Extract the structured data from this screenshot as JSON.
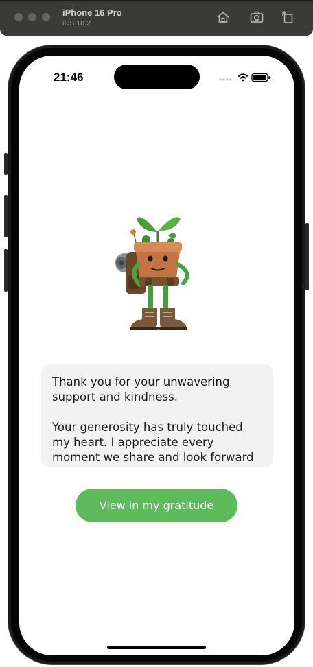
{
  "simulator": {
    "device_name": "iPhone 16 Pro",
    "os_version": "iOS 18.2",
    "icons": [
      "home-icon",
      "screenshot-icon",
      "rotate-icon"
    ]
  },
  "status_bar": {
    "time": "21:46",
    "icons": [
      "signal-icon",
      "wifi-icon",
      "battery-icon"
    ]
  },
  "content": {
    "illustration": "potted-plant-hiker-illustration",
    "message_paragraphs": [
      "Thank you for your unwavering support and kindness.",
      "Your generosity has truly touched my heart. I appreciate every moment we share and look forward to creating more"
    ],
    "cta_label": "View in my gratitude"
  },
  "colors": {
    "accent_button": "#5dbb5b",
    "card_background": "#f2f2f2",
    "toolbar_background": "#3a3a38"
  }
}
